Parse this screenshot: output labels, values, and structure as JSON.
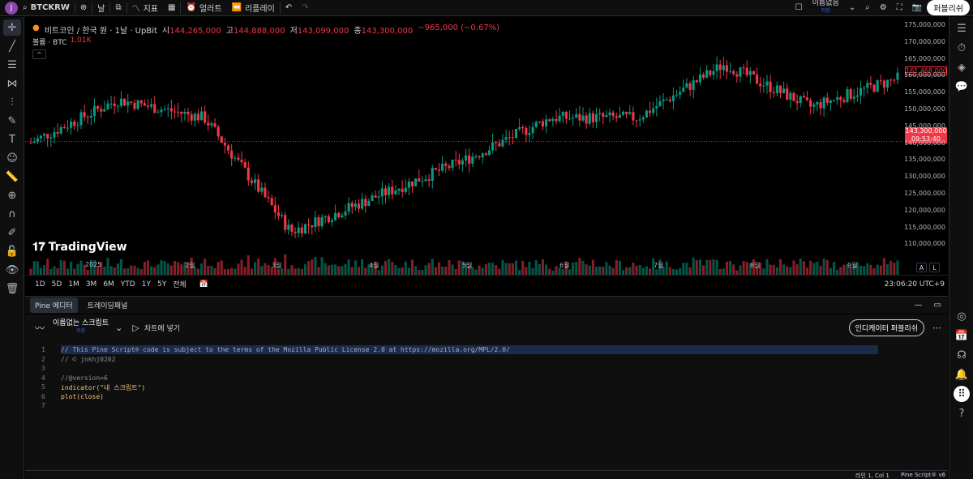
{
  "topbar": {
    "avatar": "J",
    "symbol": "BTCKRW",
    "interval": "날",
    "indicators": "지표",
    "alert": "얼러트",
    "replay": "리플레이",
    "layout_name": "이름없음",
    "layout_status": "저장",
    "publish": "퍼블리쉬"
  },
  "legend": {
    "title": "비트코인 / 한국 원 · 1날 · UpBit",
    "o_label": "시",
    "o_value": "144,265,000",
    "h_label": "고",
    "h_value": "144,888,000",
    "l_label": "저",
    "l_value": "143,099,000",
    "c_label": "종",
    "c_value": "143,300,000",
    "change": "−965,000 (−0.67%)",
    "volume_label": "볼륨 · BTC",
    "volume_value": "1.01K",
    "collapse": "^"
  },
  "yaxis": {
    "labels": [
      "175,000,000",
      "170,000,000",
      "165,000,000",
      "160,000,000",
      "155,000,000",
      "150,000,000",
      "145,000,000",
      "140,000,000",
      "135,000,000",
      "130,000,000",
      "125,000,000",
      "120,000,000",
      "115,000,000",
      "110,000,000"
    ],
    "tag_high": "161,468,000",
    "tag_last": "143,300,000",
    "tag_countdown": "09:53:40"
  },
  "xaxis": {
    "labels": [
      "2025",
      "2월",
      "3월",
      "4월",
      "5월",
      "6월",
      "7월",
      "8월",
      "9월"
    ]
  },
  "chart_data": {
    "type": "candlestick",
    "x": [
      "2025-01",
      "2025-02",
      "2025-03",
      "2025-04",
      "2025-05",
      "2025-06",
      "2025-07",
      "2025-08",
      "2025-09"
    ],
    "close": [
      143000000,
      155000000,
      150000000,
      118000000,
      128000000,
      138000000,
      150000000,
      150000000,
      165000000,
      153000000,
      161000000
    ],
    "last_price": 143300000,
    "ylim": [
      110000000,
      176000000
    ]
  },
  "scale_buttons": {
    "auto": "A",
    "log": "L"
  },
  "ranges": [
    "1D",
    "5D",
    "1M",
    "3M",
    "6M",
    "YTD",
    "1Y",
    "5Y",
    "전체"
  ],
  "clock": "23:06:20 UTC+9",
  "logo": "TradingView",
  "panel_tabs": [
    "Pine 에디터",
    "트레이딩패널"
  ],
  "editor": {
    "script_name": "이름없는 스크립트",
    "script_status": "저장",
    "add_to_chart": "차트에 넣기",
    "publish_indicator": "인디케이터 퍼블리쉬",
    "lines": [
      "// This Pine Script® code is subject to the terms of the Mozilla Public License 2.0 at https://mozilla.org/MPL/2.0/",
      "// © jnkhj0202",
      "",
      "//@version=6",
      "indicator(\"내 스크립트\")",
      "plot(close)",
      ""
    ]
  },
  "status": {
    "position": "라인 1, Col 1",
    "version": "Pine Script® v6"
  },
  "colors": {
    "up": "#089981",
    "down": "#f23645",
    "bg": "#000000"
  }
}
